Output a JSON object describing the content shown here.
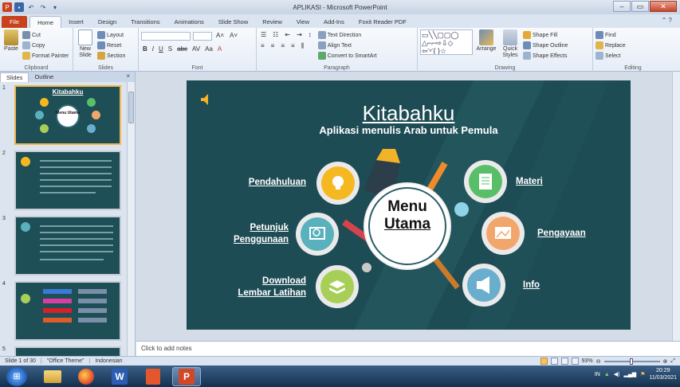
{
  "titlebar": {
    "title": "APLIKASI - Microsoft PowerPoint",
    "qat_icons": [
      "powerpoint-app-icon",
      "save-icon",
      "undo-icon",
      "redo-icon",
      "customize-icon"
    ],
    "controls": {
      "minimize": "–",
      "maximize": "▭",
      "close": "✕"
    }
  },
  "ribbon_tabs": [
    "File",
    "Home",
    "Insert",
    "Design",
    "Transitions",
    "Animations",
    "Slide Show",
    "Review",
    "View",
    "Add-Ins",
    "Foxit Reader PDF"
  ],
  "active_tab": "Home",
  "ribbon": {
    "clipboard": {
      "label": "Clipboard",
      "paste": "Paste",
      "cut": "Cut",
      "copy": "Copy",
      "format_painter": "Format Painter"
    },
    "slides": {
      "label": "Slides",
      "new_slide": "New Slide",
      "layout": "Layout",
      "reset": "Reset",
      "section": "Section"
    },
    "font": {
      "label": "Font",
      "buttons": [
        "B",
        "I",
        "U",
        "S",
        "abc",
        "AV",
        "Aa",
        "A"
      ]
    },
    "paragraph": {
      "label": "Paragraph",
      "text_direction": "Text Direction",
      "align_text": "Align Text",
      "convert_smartart": "Convert to SmartArt"
    },
    "drawing": {
      "label": "Drawing",
      "arrange": "Arrange",
      "quick_styles": "Quick Styles",
      "shape_fill": "Shape Fill",
      "shape_outline": "Shape Outline",
      "shape_effects": "Shape Effects"
    },
    "editing": {
      "label": "Editing",
      "find": "Find",
      "replace": "Replace",
      "select": "Select"
    }
  },
  "pane": {
    "tabs": [
      "Slides",
      "Outline"
    ],
    "active_tab": "Slides",
    "close": "×",
    "thumbnails": [
      {
        "num": "1",
        "title": "Kitabahku",
        "center": "Menu Utama"
      },
      {
        "num": "2"
      },
      {
        "num": "3"
      },
      {
        "num": "4"
      },
      {
        "num": "5"
      }
    ]
  },
  "slide": {
    "title": "Kitabahku",
    "subtitle": "Aplikasi menulis Arab untuk Pemula",
    "center_line1": "Menu",
    "center_line2": "Utama",
    "left_items": [
      {
        "label_lines": [
          "Pendahuluan"
        ],
        "color": "#f5b820"
      },
      {
        "label_lines": [
          "Petunjuk",
          "Penggunaan"
        ],
        "color": "#58b1bc"
      },
      {
        "label_lines": [
          "Download",
          "Lembar Latihan"
        ],
        "color": "#a7cf58"
      }
    ],
    "right_items": [
      {
        "label_lines": [
          "Materi"
        ],
        "color": "#58bf68"
      },
      {
        "label_lines": [
          "Pengayaan"
        ],
        "color": "#f3a66b"
      },
      {
        "label_lines": [
          "Info"
        ],
        "color": "#6aaecd"
      }
    ],
    "icons": [
      "speaker-icon",
      "lightbulb-hand-icon",
      "search-screen-icon",
      "layers-icon",
      "document-icon",
      "picture-icon",
      "megaphone-icon"
    ]
  },
  "notes_placeholder": "Click to add notes",
  "status": {
    "slide_info": "Slide 1 of 30",
    "theme": "\"Office Theme\"",
    "language": "Indonesian",
    "zoom": "93%"
  },
  "taskbar": {
    "apps": [
      "explorer-icon",
      "firefox-icon",
      "word-icon",
      "file-icon",
      "powerpoint-icon"
    ],
    "word_letter": "W",
    "ppt_letter": "P",
    "lang": "IN",
    "time": "20:29",
    "date": "11/03/2021"
  },
  "colors": {
    "slide_bg": "#1e4c55",
    "title_color": "#ffffff",
    "file_tab": "#c8421d"
  }
}
